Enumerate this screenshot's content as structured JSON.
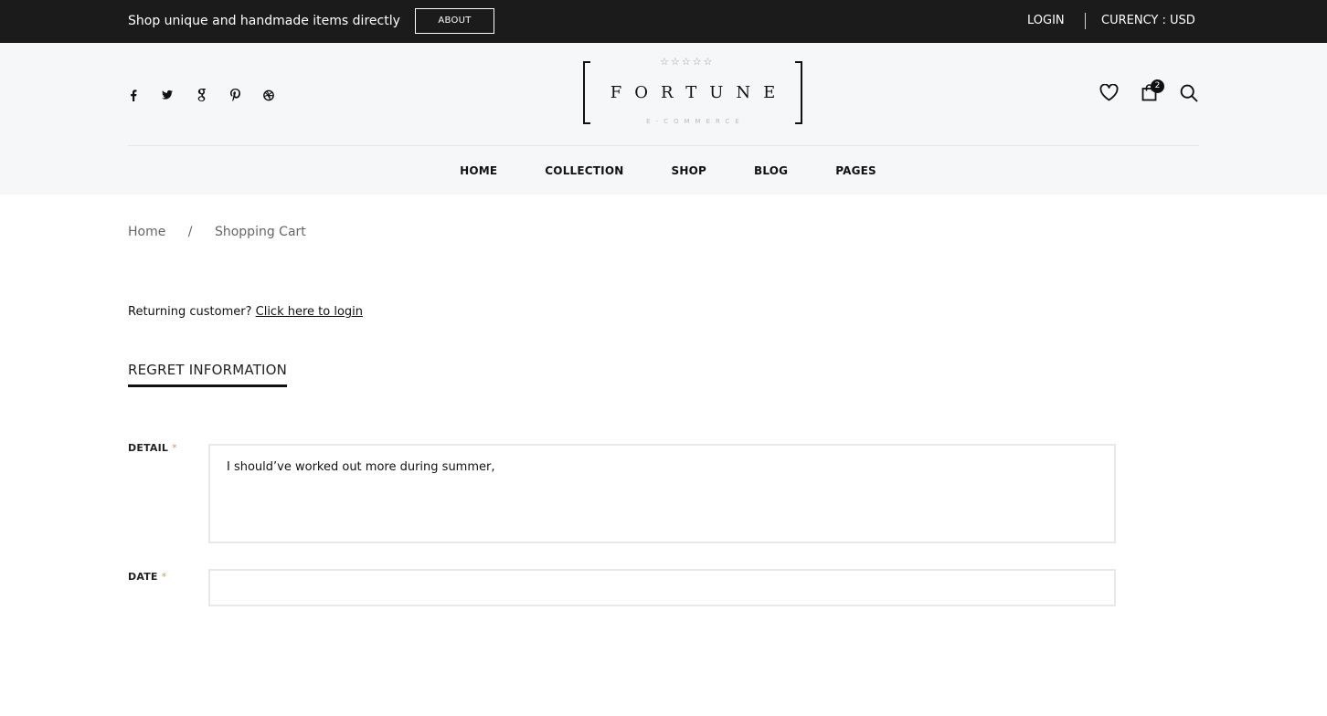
{
  "topbar": {
    "tagline": "Shop unique and handmade items directly",
    "about_label": "ABOUT",
    "login_label": "LOGIN",
    "currency_label": "CURENCY : USD"
  },
  "header": {
    "social_icons": [
      "facebook-icon",
      "twitter-icon",
      "google-icon",
      "pinterest-icon",
      "dribbble-icon"
    ],
    "logo": {
      "stars": "☆☆☆☆☆",
      "word": "FORTUNE",
      "sub": "E-COMMERCE"
    },
    "cart_count": "2"
  },
  "nav": {
    "items": [
      "HOME",
      "COLLECTION",
      "SHOP",
      "BLOG",
      "PAGES"
    ]
  },
  "breadcrumb": {
    "home": "Home",
    "separator": "/",
    "current": "Shopping Cart"
  },
  "returning": {
    "text": "Returning customer? ",
    "link": "Click here to login"
  },
  "form": {
    "title": "REGRET INFORMATION",
    "required_mark": "*",
    "detail_label": "DETAIL",
    "detail_value": "I should’ve worked out more during summer,",
    "date_label": "DATE",
    "date_value": ""
  }
}
